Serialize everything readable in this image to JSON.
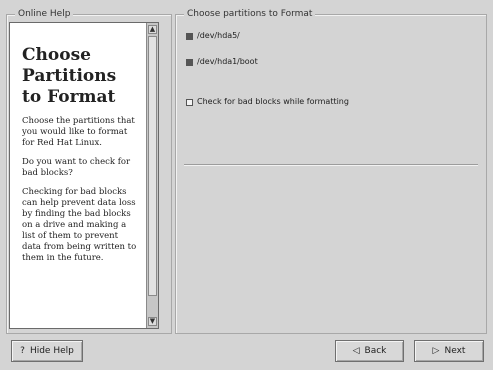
{
  "online_help": {
    "group_title": "Online Help",
    "heading": "Choose Partitions to Format",
    "paragraphs": [
      "Choose the partitions that you would like to format for Red Hat Linux.",
      "Do you want to check for bad blocks?",
      "Checking for bad blocks can help prevent data loss by finding the bad blocks on a drive and making a list of them to prevent data from being written to them in the future."
    ],
    "scroll_up_icon": "▲",
    "scroll_down_icon": "▼"
  },
  "partitions": {
    "group_title": "Choose partitions to Format",
    "items": [
      {
        "device": "/dev/hda5",
        "mount": "/",
        "checked": true
      },
      {
        "device": "/dev/hda1",
        "mount": "/boot",
        "checked": true
      }
    ],
    "bad_blocks_label": "Check for bad blocks while formatting",
    "bad_blocks_checked": false
  },
  "buttons": {
    "hide_help": "Hide Help",
    "back": "Back",
    "next": "Next",
    "hide_help_icon": "?",
    "back_icon": "◁",
    "next_icon": "▷"
  }
}
